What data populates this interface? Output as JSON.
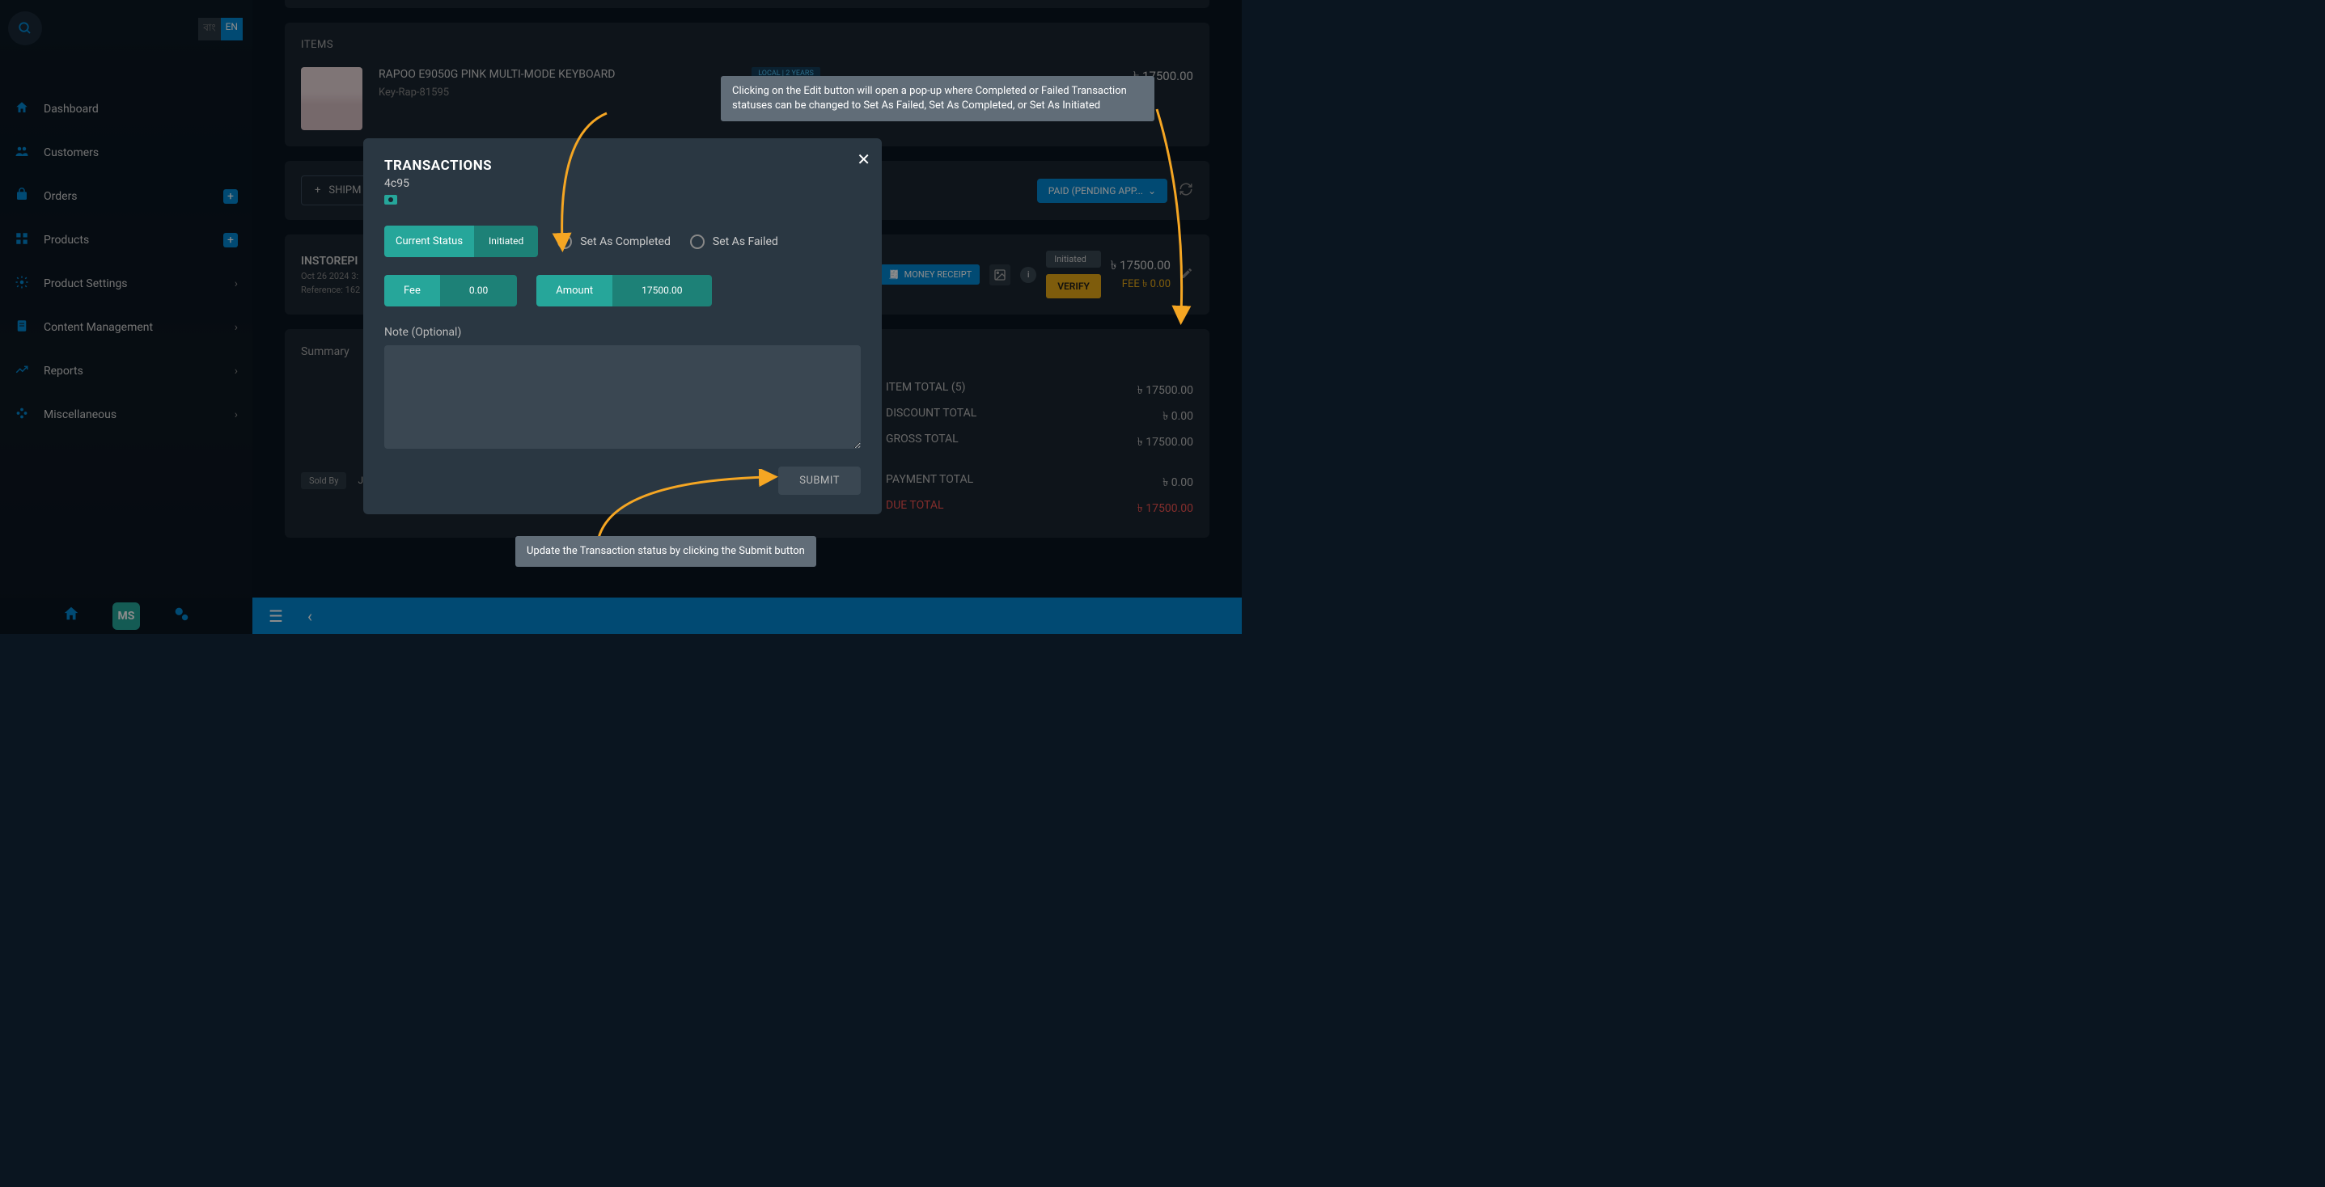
{
  "sidebar": {
    "lang_bn": "বাং",
    "lang_en": "EN",
    "items": [
      {
        "icon": "home-icon",
        "label": "Dashboard"
      },
      {
        "icon": "people-icon",
        "label": "Customers"
      },
      {
        "icon": "cart-icon",
        "label": "Orders",
        "plus": true
      },
      {
        "icon": "cube-icon",
        "label": "Products",
        "plus": true
      },
      {
        "icon": "gear-icon",
        "label": "Product Settings",
        "chevron": true
      },
      {
        "icon": "doc-icon",
        "label": "Content Management",
        "chevron": true
      },
      {
        "icon": "chart-icon",
        "label": "Reports",
        "chevron": true
      },
      {
        "icon": "dots-icon",
        "label": "Miscellaneous",
        "chevron": true
      }
    ]
  },
  "items_section": {
    "title": "ITEMS",
    "product_name": "RAPOO E9050G PINK MULTI-MODE KEYBOARD",
    "product_sku": "Key-Rap-81595",
    "badge": "LOCAL | 2 YEARS",
    "price": "৳ 17500.00"
  },
  "shipment": {
    "btn": "SHIPM",
    "paid": "PAID (PENDING APP..."
  },
  "transaction_row": {
    "title": "INSTOREPI",
    "datetime": "Oct 26 2024 3:",
    "reference": "Reference: 162",
    "money_receipt": "MONEY RECEIPT",
    "status": "Initiated",
    "verify": "VERIFY",
    "amount": "৳ 17500.00",
    "fee": "FEE ৳ 0.00"
  },
  "summary": {
    "title": "Summary",
    "sold_by_label": "Sold By",
    "sold_by_name": "Josephine Roy",
    "rows": [
      {
        "label": "ITEM TOTAL (5)",
        "value": "৳ 17500.00"
      },
      {
        "label": "DISCOUNT TOTAL",
        "value": "৳ 0.00"
      },
      {
        "label": "GROSS TOTAL",
        "value": "৳ 17500.00"
      },
      {
        "label": "PAYMENT TOTAL",
        "value": "৳ 0.00"
      },
      {
        "label": "DUE TOTAL",
        "value": "৳ 17500.00",
        "due": true
      }
    ]
  },
  "modal": {
    "title": "TRANSACTIONS",
    "id": "4c95",
    "current_status_label": "Current Status",
    "current_status_value": "Initiated",
    "radio_completed": "Set As Completed",
    "radio_failed": "Set As Failed",
    "fee_label": "Fee",
    "fee_value": "0.00",
    "amount_label": "Amount",
    "amount_value": "17500.00",
    "note_label": "Note (Optional)",
    "submit": "SUBMIT"
  },
  "tooltips": {
    "tip1": "Clicking on the Edit button will open a pop-up where Completed or Failed Transaction statuses can be changed to Set As Failed, Set As Completed, or Set As Initiated",
    "tip2": "Update the Transaction status by clicking the Submit button"
  },
  "bottom": {
    "ms": "MS"
  }
}
